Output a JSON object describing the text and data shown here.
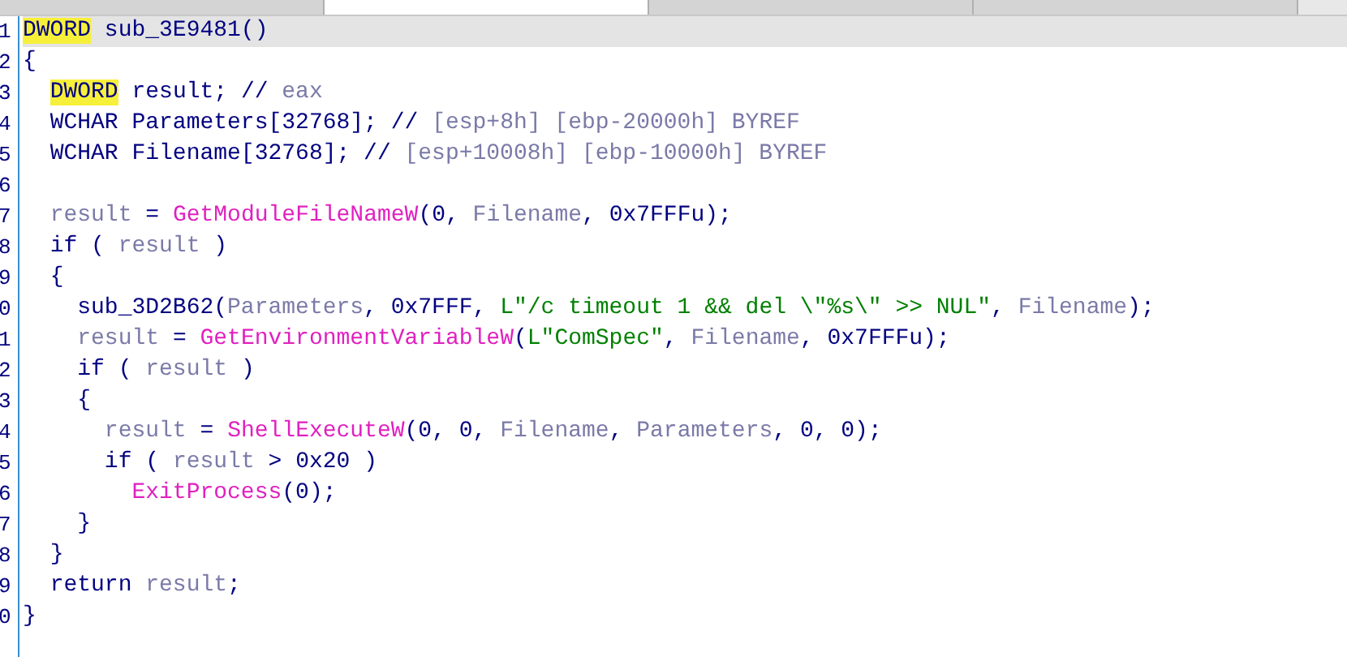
{
  "tabs": [
    {
      "selected": false
    },
    {
      "selected": true
    },
    {
      "selected": false
    },
    {
      "selected": false
    }
  ],
  "code_lines": [
    {
      "number": "1",
      "current": true,
      "tokens": [
        {
          "kind": "highlight",
          "text": "DWORD"
        },
        {
          "kind": "plain",
          "text": " sub_3E9481()"
        }
      ]
    },
    {
      "number": "2",
      "current": false,
      "tokens": [
        {
          "kind": "plain",
          "text": "{"
        }
      ]
    },
    {
      "number": "3",
      "current": false,
      "tokens": [
        {
          "kind": "highlight",
          "text": "  DWORD"
        },
        {
          "kind": "plain",
          "text": " result; // "
        },
        {
          "kind": "var",
          "text": "eax"
        }
      ]
    },
    {
      "number": "4",
      "current": false,
      "tokens": [
        {
          "kind": "plain",
          "text": "  WCHAR Parameters[32768]; // "
        },
        {
          "kind": "var",
          "text": "[esp+8h] [ebp-20000h] BYREF"
        }
      ]
    },
    {
      "number": "5",
      "current": false,
      "tokens": [
        {
          "kind": "plain",
          "text": "  WCHAR Filename[32768]; // "
        },
        {
          "kind": "var",
          "text": "[esp+10008h] [ebp-10000h] BYREF"
        }
      ]
    },
    {
      "number": "6",
      "current": false
    },
    {
      "number": "7",
      "current": false,
      "tokens": [
        {
          "kind": "var",
          "text": "  result"
        },
        {
          "kind": "plain",
          "text": " = "
        },
        {
          "kind": "func",
          "text": "GetModuleFileNameW"
        },
        {
          "kind": "plain",
          "text": "(0, "
        },
        {
          "kind": "var",
          "text": "Filename"
        },
        {
          "kind": "plain",
          "text": ", 0x7FFFu);"
        }
      ]
    },
    {
      "number": "8",
      "current": false,
      "tokens": [
        {
          "kind": "plain",
          "text": "  if ( "
        },
        {
          "kind": "var",
          "text": "result"
        },
        {
          "kind": "plain",
          "text": " )"
        }
      ]
    },
    {
      "number": "9",
      "current": false,
      "tokens": [
        {
          "kind": "plain",
          "text": "  {"
        }
      ]
    },
    {
      "number": "0",
      "current": false,
      "tokens": [
        {
          "kind": "plain",
          "text": "    sub_3D2B62("
        },
        {
          "kind": "var",
          "text": "Parameters"
        },
        {
          "kind": "plain",
          "text": ", 0x7FFF, "
        },
        {
          "kind": "string",
          "text": "L\"/c timeout 1 && del \\\"%s\\\" >> NUL\""
        },
        {
          "kind": "plain",
          "text": ", "
        },
        {
          "kind": "var",
          "text": "Filename"
        },
        {
          "kind": "plain",
          "text": ");"
        }
      ]
    },
    {
      "number": "1",
      "current": false,
      "tokens": [
        {
          "kind": "var",
          "text": "    result"
        },
        {
          "kind": "plain",
          "text": " = "
        },
        {
          "kind": "func",
          "text": "GetEnvironmentVariableW"
        },
        {
          "kind": "plain",
          "text": "("
        },
        {
          "kind": "string",
          "text": "L\"ComSpec\""
        },
        {
          "kind": "plain",
          "text": ", "
        },
        {
          "kind": "var",
          "text": "Filename"
        },
        {
          "kind": "plain",
          "text": ", 0x7FFFu);"
        }
      ]
    },
    {
      "number": "2",
      "current": false,
      "tokens": [
        {
          "kind": "plain",
          "text": "    if ( "
        },
        {
          "kind": "var",
          "text": "result"
        },
        {
          "kind": "plain",
          "text": " )"
        }
      ]
    },
    {
      "number": "3",
      "current": false,
      "tokens": [
        {
          "kind": "plain",
          "text": "    {"
        }
      ]
    },
    {
      "number": "4",
      "current": false,
      "tokens": [
        {
          "kind": "var",
          "text": "      result"
        },
        {
          "kind": "plain",
          "text": " = "
        },
        {
          "kind": "func",
          "text": "ShellExecuteW"
        },
        {
          "kind": "plain",
          "text": "(0, 0, "
        },
        {
          "kind": "var",
          "text": "Filename"
        },
        {
          "kind": "plain",
          "text": ", "
        },
        {
          "kind": "var",
          "text": "Parameters"
        },
        {
          "kind": "plain",
          "text": ", 0, 0);"
        }
      ]
    },
    {
      "number": "5",
      "current": false,
      "tokens": [
        {
          "kind": "plain",
          "text": "      if ( "
        },
        {
          "kind": "var",
          "text": "result"
        },
        {
          "kind": "plain",
          "text": " > 0x20 )"
        }
      ]
    },
    {
      "number": "6",
      "current": false,
      "tokens": [
        {
          "kind": "func",
          "text": "        ExitProcess"
        },
        {
          "kind": "plain",
          "text": "(0);"
        }
      ]
    },
    {
      "number": "7",
      "current": false,
      "tokens": [
        {
          "kind": "plain",
          "text": "    }"
        }
      ]
    },
    {
      "number": "8",
      "current": false,
      "tokens": [
        {
          "kind": "plain",
          "text": "  }"
        }
      ]
    },
    {
      "number": "9",
      "current": false,
      "tokens": [
        {
          "kind": "plain",
          "text": "  return "
        },
        {
          "kind": "var",
          "text": "result"
        },
        {
          "kind": "plain",
          "text": ";"
        }
      ]
    },
    {
      "number": "0",
      "current": false,
      "tokens": [
        {
          "kind": "plain",
          "text": "}"
        }
      ]
    }
  ]
}
